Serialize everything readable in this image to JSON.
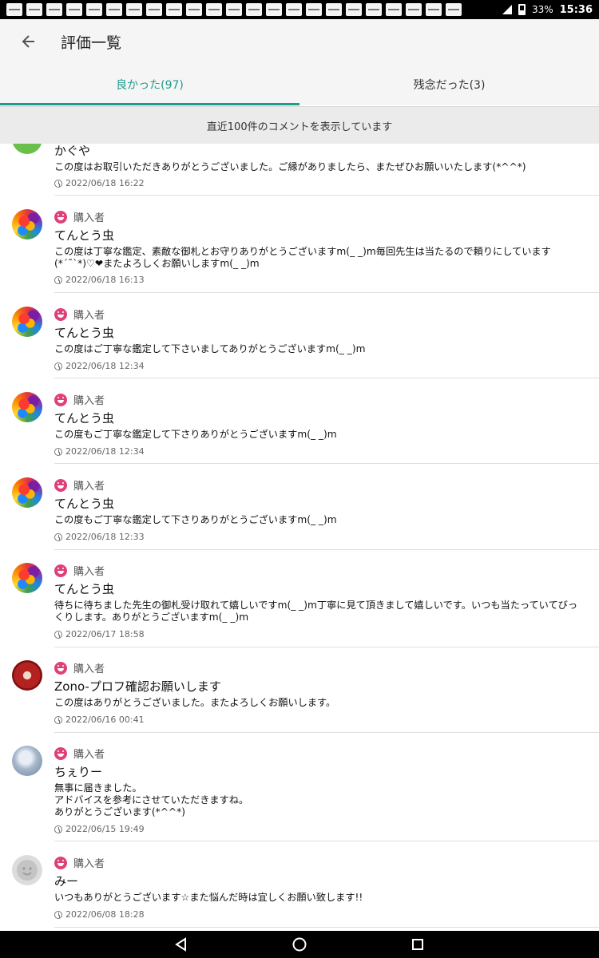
{
  "status_bar": {
    "battery": "33%",
    "time": "15:36"
  },
  "header": {
    "title": "評価一覧",
    "back_icon": "arrow-left-icon"
  },
  "tabs": [
    {
      "label": "良かった(97)",
      "active": true
    },
    {
      "label": "残念だった(3)",
      "active": false
    }
  ],
  "notice": "直近100件のコメントを表示しています",
  "accent_color": "#1e9c8d",
  "badge_color": "#e0407a",
  "reviews": [
    {
      "name": "かぐや",
      "comment": "この度はお取引いただきありがとうございました。ご縁がありましたら、またぜひお願いいたします(*^^*)",
      "date": "2022/06/18 16:22"
    },
    {
      "role": "購入者",
      "name": "てんとう虫",
      "comment": "この度は丁寧な鑑定、素敵な御札とお守りありがとうございますm(_ _)m毎回先生は当たるので頼りにしています\n(*´˘`*)♡❤またよろしくお願いしますm(_ _)m",
      "date": "2022/06/18 16:13"
    },
    {
      "role": "購入者",
      "name": "てんとう虫",
      "comment": "この度はご丁寧な鑑定して下さいましてありがとうございますm(_ _)m",
      "date": "2022/06/18 12:34"
    },
    {
      "role": "購入者",
      "name": "てんとう虫",
      "comment": "この度もご丁寧な鑑定して下さりありがとうございますm(_ _)m",
      "date": "2022/06/18 12:34"
    },
    {
      "role": "購入者",
      "name": "てんとう虫",
      "comment": "この度もご丁寧な鑑定して下さりありがとうございますm(_ _)m",
      "date": "2022/06/18 12:33"
    },
    {
      "role": "購入者",
      "name": "てんとう虫",
      "comment": "待ちに待ちました先生の御札受け取れて嬉しいですm(_ _)m丁寧に見て頂きまして嬉しいです。いつも当たっていてびっ\nくりします。ありがとうございますm(_ _)m",
      "date": "2022/06/17 18:58"
    },
    {
      "role": "購入者",
      "name": "Zono-プロフ確認お願いします",
      "comment": "この度はありがとうございました。またよろしくお願いします。",
      "date": "2022/06/16 00:41"
    },
    {
      "role": "購入者",
      "name": "ちぇりー",
      "comment": "無事に届きました。\nアドバイスを参考にさせていただきますね。\nありがとうございます(*^^*)",
      "date": "2022/06/15 19:49"
    },
    {
      "role": "購入者",
      "name": "みー",
      "comment": "いつもありがとうございます☆また悩んだ時は宜しくお願い致します!!",
      "date": "2022/06/08 18:28"
    }
  ]
}
